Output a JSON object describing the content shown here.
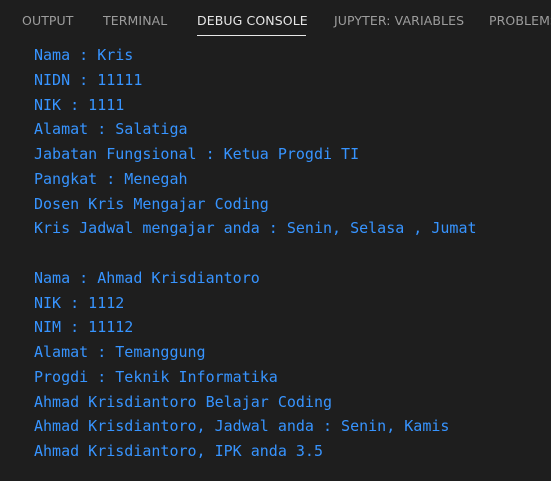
{
  "tabs": [
    {
      "label": "OUTPUT"
    },
    {
      "label": "TERMINAL"
    },
    {
      "label": "DEBUG CONSOLE"
    },
    {
      "label": "JUPYTER: VARIABLES"
    },
    {
      "label": "PROBLEMS"
    }
  ],
  "active_tab": "DEBUG CONSOLE",
  "colors": {
    "background": "#1e1e1e",
    "console_text": "#3794ff",
    "tab_inactive": "#9d9d9d",
    "tab_active": "#e7e7e7"
  },
  "console": {
    "lines": [
      "Nama : Kris",
      "NIDN : 11111",
      "NIK : 1111",
      "Alamat : Salatiga",
      "Jabatan Fungsional : Ketua Progdi TI",
      "Pangkat : Menegah",
      "Dosen Kris Mengajar Coding",
      "Kris Jadwal mengajar anda : Senin, Selasa , Jumat",
      "",
      "Nama : Ahmad Krisdiantoro",
      "NIK : 1112",
      "NIM : 11112",
      "Alamat : Temanggung",
      "Progdi : Teknik Informatika",
      "Ahmad Krisdiantoro Belajar Coding",
      "Ahmad Krisdiantoro, Jadwal anda : Senin, Kamis",
      "Ahmad Krisdiantoro, IPK anda 3.5"
    ]
  }
}
